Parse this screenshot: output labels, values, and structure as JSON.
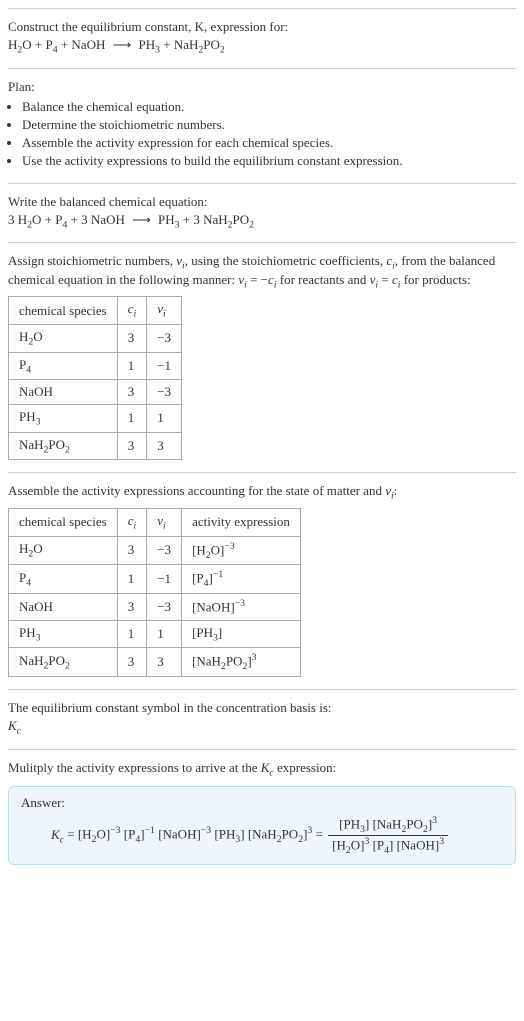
{
  "prompt": "Construct the equilibrium constant, K, expression for:",
  "unbalanced": "H₂O + P₄ + NaOH ⟶ PH₃ + NaH₂PO₂",
  "plan_heading": "Plan:",
  "plan": [
    "Balance the chemical equation.",
    "Determine the stoichiometric numbers.",
    "Assemble the activity expression for each chemical species.",
    "Use the activity expressions to build the equilibrium constant expression."
  ],
  "balanced_heading": "Write the balanced chemical equation:",
  "balanced": "3 H₂O + P₄ + 3 NaOH ⟶ PH₃ + 3 NaH₂PO₂",
  "stoich_text": "Assign stoichiometric numbers, νᵢ, using the stoichiometric coefficients, cᵢ, from the balanced chemical equation in the following manner: νᵢ = −cᵢ for reactants and νᵢ = cᵢ for products:",
  "table1": {
    "headers": [
      "chemical species",
      "cᵢ",
      "νᵢ"
    ],
    "rows": [
      [
        "H₂O",
        "3",
        "−3"
      ],
      [
        "P₄",
        "1",
        "−1"
      ],
      [
        "NaOH",
        "3",
        "−3"
      ],
      [
        "PH₃",
        "1",
        "1"
      ],
      [
        "NaH₂PO₂",
        "3",
        "3"
      ]
    ]
  },
  "activity_text": "Assemble the activity expressions accounting for the state of matter and νᵢ:",
  "table2": {
    "headers": [
      "chemical species",
      "cᵢ",
      "νᵢ",
      "activity expression"
    ],
    "rows": [
      [
        "H₂O",
        "3",
        "−3",
        "[H₂O]⁻³"
      ],
      [
        "P₄",
        "1",
        "−1",
        "[P₄]⁻¹"
      ],
      [
        "NaOH",
        "3",
        "−3",
        "[NaOH]⁻³"
      ],
      [
        "PH₃",
        "1",
        "1",
        "[PH₃]"
      ],
      [
        "NaH₂PO₂",
        "3",
        "3",
        "[NaH₂PO₂]³"
      ]
    ]
  },
  "eq_symbol_text": "The equilibrium constant symbol in the concentration basis is:",
  "eq_symbol": "K_c",
  "multiply_text": "Mulitply the activity expressions to arrive at the K_c expression:",
  "answer_label": "Answer:",
  "answer_lhs": "K_c = [H₂O]⁻³ [P₄]⁻¹ [NaOH]⁻³ [PH₃] [NaH₂PO₂]³ =",
  "answer_num": "[PH₃] [NaH₂PO₂]³",
  "answer_den": "[H₂O]³ [P₄] [NaOH]³",
  "chart_data": {
    "type": "table",
    "tables": [
      {
        "title": "Stoichiometric numbers",
        "columns": [
          "chemical species",
          "c_i",
          "ν_i"
        ],
        "rows": [
          {
            "species": "H2O",
            "c_i": 3,
            "nu_i": -3
          },
          {
            "species": "P4",
            "c_i": 1,
            "nu_i": -1
          },
          {
            "species": "NaOH",
            "c_i": 3,
            "nu_i": -3
          },
          {
            "species": "PH3",
            "c_i": 1,
            "nu_i": 1
          },
          {
            "species": "NaH2PO2",
            "c_i": 3,
            "nu_i": 3
          }
        ]
      },
      {
        "title": "Activity expressions",
        "columns": [
          "chemical species",
          "c_i",
          "ν_i",
          "activity expression"
        ],
        "rows": [
          {
            "species": "H2O",
            "c_i": 3,
            "nu_i": -3,
            "activity": "[H2O]^-3"
          },
          {
            "species": "P4",
            "c_i": 1,
            "nu_i": -1,
            "activity": "[P4]^-1"
          },
          {
            "species": "NaOH",
            "c_i": 3,
            "nu_i": -3,
            "activity": "[NaOH]^-3"
          },
          {
            "species": "PH3",
            "c_i": 1,
            "nu_i": 1,
            "activity": "[PH3]"
          },
          {
            "species": "NaH2PO2",
            "c_i": 3,
            "nu_i": 3,
            "activity": "[NaH2PO2]^3"
          }
        ]
      }
    ]
  }
}
